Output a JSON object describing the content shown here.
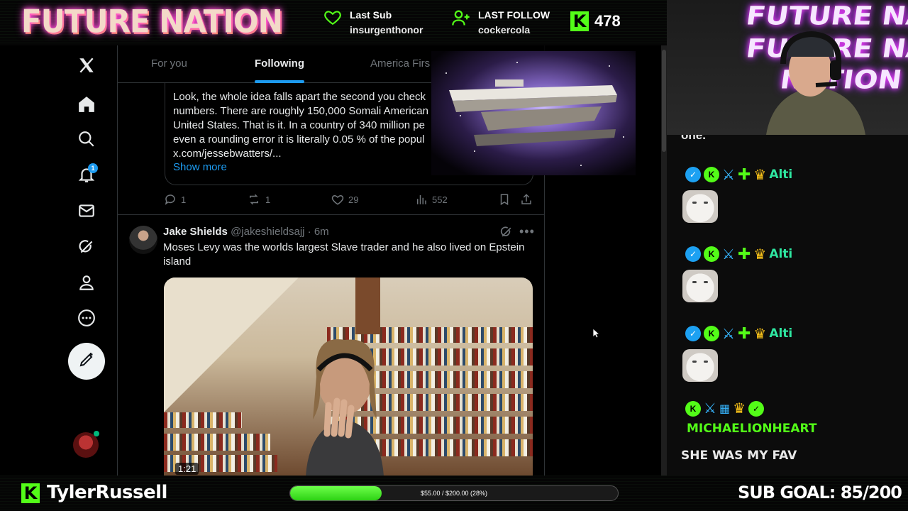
{
  "overlay": {
    "brand": "FUTURE NATION",
    "last_sub_label": "Last Sub",
    "last_sub_user": "insurgenthonor",
    "last_follow_label": "LAST FOLLOW",
    "last_follow_user": "cockercola",
    "kick_count": "478",
    "kick_logo": "K",
    "accent_color": "#53fc18"
  },
  "x": {
    "tabs": [
      {
        "label": "For you"
      },
      {
        "label": "Following"
      },
      {
        "label": "America Firs"
      }
    ],
    "notification_badge": "1",
    "quoted_post": {
      "text": "Look, the whole idea falls apart the second you check\nnumbers. There are roughly 150,000 Somali American\nUnited States. That is it. In a country of 340 million pe\neven a rounding error it is literally 0.05 % of the popul\nx.com/jessebwatters/...",
      "show_more": "Show more"
    },
    "actions": {
      "replies": "1",
      "reposts": "1",
      "likes": "29",
      "views": "552"
    },
    "tweet2": {
      "name": "Jake Shields",
      "handle": "@jakeshieldsajj · 6m",
      "text": "Moses Levy was the worlds largest Slave trader and he also lived on Epstein island",
      "video_time": "1:21"
    }
  },
  "chat": {
    "cut_text": "one.",
    "messages": [
      {
        "user": "Alti"
      },
      {
        "user": "Alti"
      },
      {
        "user": "Alti"
      },
      {
        "user": "MICHAELIONHEART",
        "text": "SHE WAS MY FAV"
      }
    ]
  },
  "bottom": {
    "streamer_k": "K",
    "streamer": "TylerRussell",
    "goal_text": "$55.00 / $200.00 (28%)",
    "goal_percent": 28,
    "sub_goal": "SUB GOAL: 85/200"
  },
  "icons": [
    "x-logo-icon",
    "home-icon",
    "search-icon",
    "bell-icon",
    "mail-icon",
    "grok-icon",
    "profile-icon",
    "more-icon",
    "compose-icon",
    "heart-icon",
    "add-user-icon",
    "reply-icon",
    "repost-icon",
    "like-icon",
    "views-icon",
    "bookmark-icon",
    "share-icon",
    "cursor-icon"
  ]
}
